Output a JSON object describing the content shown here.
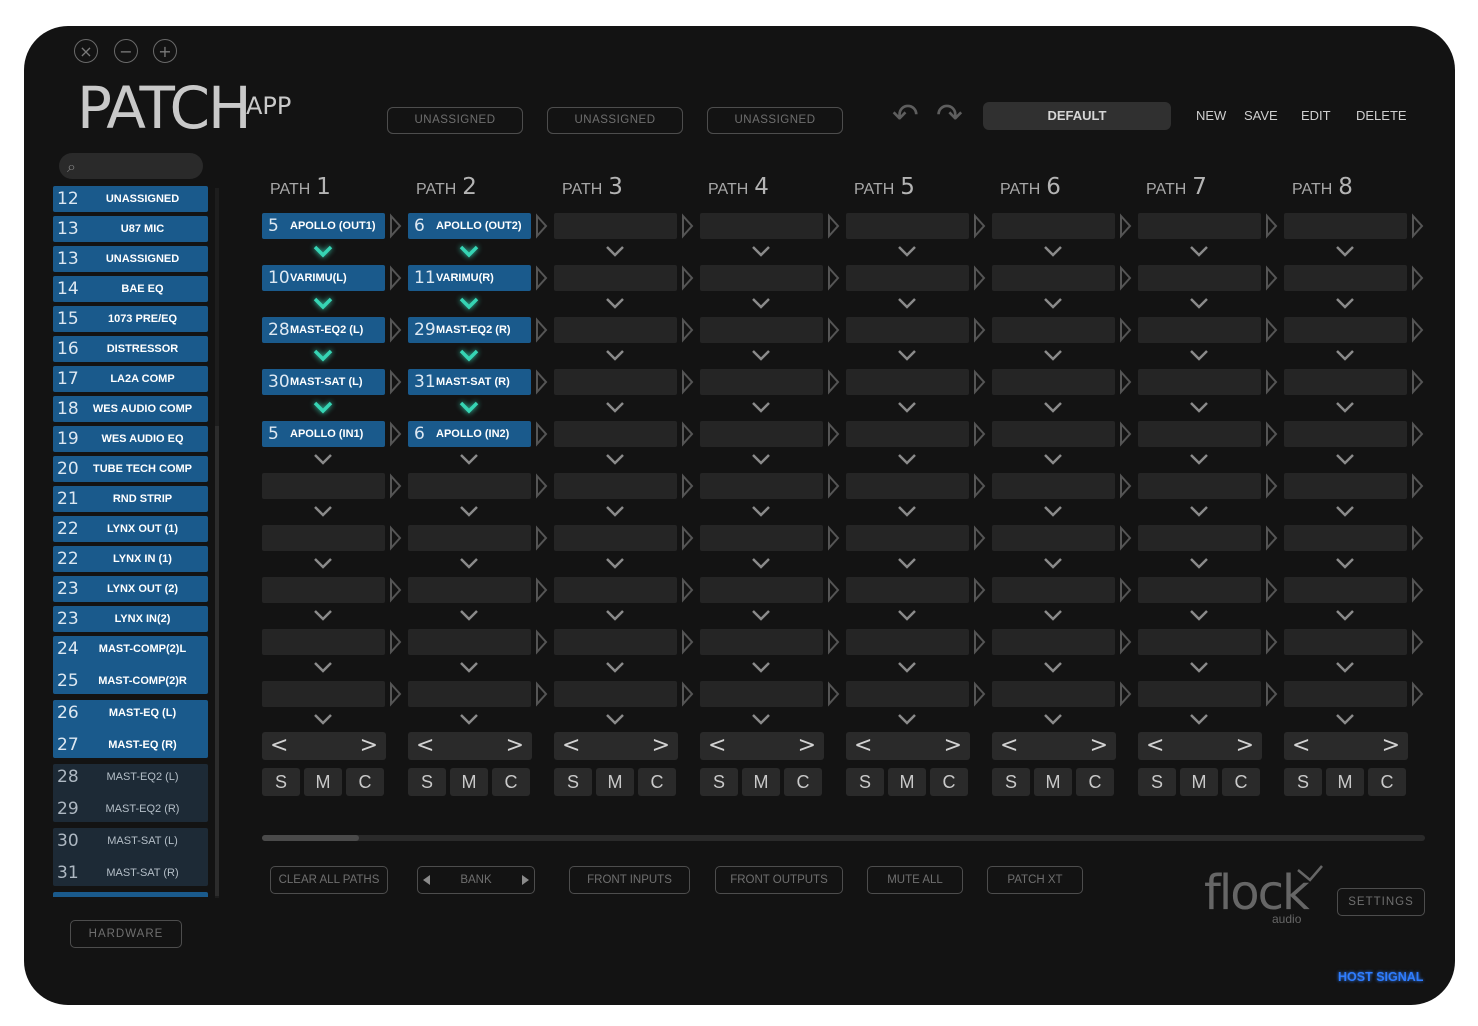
{
  "window_controls": {
    "close": "×",
    "minimize": "−",
    "maximize": "+"
  },
  "app": {
    "logo": "PATCH",
    "logo_sub": "APP"
  },
  "unassigned_buttons": [
    "UNASSIGNED",
    "UNASSIGNED",
    "UNASSIGNED"
  ],
  "preset": {
    "name": "DEFAULT",
    "actions": [
      "NEW",
      "SAVE",
      "EDIT",
      "DELETE"
    ]
  },
  "sidebar": {
    "items": [
      {
        "num": "12",
        "label": "UNASSIGNED"
      },
      {
        "num": "13",
        "label": "U87 MIC"
      },
      {
        "num": "13",
        "label": "UNASSIGNED"
      },
      {
        "num": "14",
        "label": "BAE EQ"
      },
      {
        "num": "15",
        "label": "1073 PRE/EQ"
      },
      {
        "num": "16",
        "label": "DISTRESSOR"
      },
      {
        "num": "17",
        "label": "LA2A COMP"
      },
      {
        "num": "18",
        "label": "WES AUDIO COMP"
      },
      {
        "num": "19",
        "label": "WES AUDIO EQ"
      },
      {
        "num": "20",
        "label": "TUBE TECH COMP"
      },
      {
        "num": "21",
        "label": "RND STRIP"
      },
      {
        "num": "22",
        "label": "LYNX OUT (1)"
      },
      {
        "num": "22",
        "label": "LYNX IN (1)"
      },
      {
        "num": "23",
        "label": "LYNX OUT (2)"
      },
      {
        "num": "23",
        "label": "LYNX IN(2)"
      }
    ],
    "groups": [
      {
        "style": "blue",
        "items": [
          {
            "num": "24",
            "label": "MAST-COMP(2)L"
          },
          {
            "num": "25",
            "label": "MAST-COMP(2)R"
          }
        ]
      },
      {
        "style": "blue",
        "items": [
          {
            "num": "26",
            "label": "MAST-EQ (L)"
          },
          {
            "num": "27",
            "label": "MAST-EQ (R)"
          }
        ]
      },
      {
        "style": "dark",
        "items": [
          {
            "num": "28",
            "label": "MAST-EQ2 (L)"
          },
          {
            "num": "29",
            "label": "MAST-EQ2 (R)"
          }
        ]
      },
      {
        "style": "dark",
        "items": [
          {
            "num": "30",
            "label": "MAST-SAT (L)"
          },
          {
            "num": "31",
            "label": "MAST-SAT (R)"
          }
        ]
      }
    ],
    "hardware_button": "HARDWARE"
  },
  "paths": [
    {
      "label": "PATH",
      "num": "1",
      "slots": [
        {
          "num": "5",
          "label": "APOLLO (OUT1)"
        },
        {
          "num": "10",
          "label": "VARIMU(L)"
        },
        {
          "num": "28",
          "label": "MAST-EQ2 (L)"
        },
        {
          "num": "30",
          "label": "MAST-SAT (L)"
        },
        {
          "num": "5",
          "label": "APOLLO (IN1)"
        }
      ]
    },
    {
      "label": "PATH",
      "num": "2",
      "slots": [
        {
          "num": "6",
          "label": "APOLLO (OUT2)"
        },
        {
          "num": "11",
          "label": "VARIMU(R)"
        },
        {
          "num": "29",
          "label": "MAST-EQ2 (R)"
        },
        {
          "num": "31",
          "label": "MAST-SAT (R)"
        },
        {
          "num": "6",
          "label": "APOLLO (IN2)"
        }
      ]
    },
    {
      "label": "PATH",
      "num": "3",
      "slots": []
    },
    {
      "label": "PATH",
      "num": "4",
      "slots": []
    },
    {
      "label": "PATH",
      "num": "5",
      "slots": []
    },
    {
      "label": "PATH",
      "num": "6",
      "slots": []
    },
    {
      "label": "PATH",
      "num": "7",
      "slots": []
    },
    {
      "label": "PATH",
      "num": "8",
      "slots": []
    }
  ],
  "path_nav": {
    "prev": "<",
    "next": ">"
  },
  "path_buttons": {
    "solo": "S",
    "mute": "M",
    "clear": "C"
  },
  "bottom_buttons": {
    "clear_all": "CLEAR ALL PATHS",
    "bank": "BANK",
    "front_inputs": "FRONT INPUTS",
    "front_outputs": "FRONT OUTPUTS",
    "mute_all": "MUTE ALL",
    "patch_xt": "PATCH XT"
  },
  "brand": {
    "name": "flock",
    "sub": "audio"
  },
  "settings_button": "SETTINGS",
  "status": {
    "host_signal": "HOST SIGNAL"
  },
  "colors": {
    "slot_blue": "#1a5a8c",
    "chevron_active": "#36d4b4",
    "chevron_idle": "#8a8a8a",
    "host_signal": "#2f7dff"
  }
}
